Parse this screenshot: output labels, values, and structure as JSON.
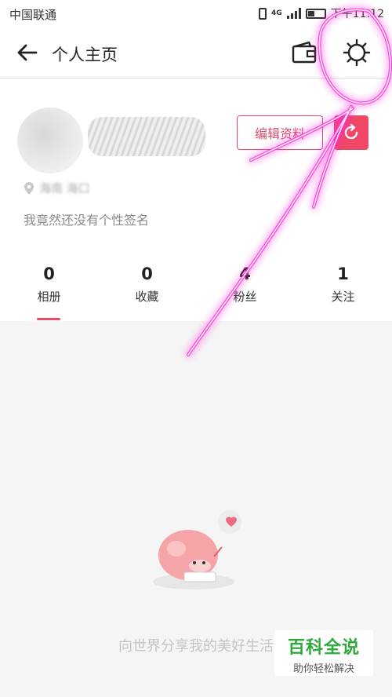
{
  "status_bar": {
    "carrier": "中国联通",
    "network": "4G",
    "time": "下午11:12"
  },
  "header": {
    "title": "个人主页",
    "back_icon": "back-arrow-icon",
    "wallet_icon": "wallet-icon",
    "settings_icon": "gear-icon"
  },
  "profile": {
    "edit_label": "编辑资料",
    "share_icon": "share-refresh-icon",
    "location": "海南 海口",
    "signature": "我竟然还没有个性签名"
  },
  "stats": [
    {
      "value": "0",
      "label": "相册"
    },
    {
      "value": "0",
      "label": "收藏"
    },
    {
      "value": "4",
      "label": "粉丝"
    },
    {
      "value": "1",
      "label": "关注"
    }
  ],
  "empty_state": {
    "message": "向世界分享我的美好生活"
  },
  "watermark": {
    "title": "百科全说",
    "subtitle": "助你轻松解决"
  },
  "colors": {
    "accent": "#f04766",
    "annotation": "#ff2bd6"
  }
}
